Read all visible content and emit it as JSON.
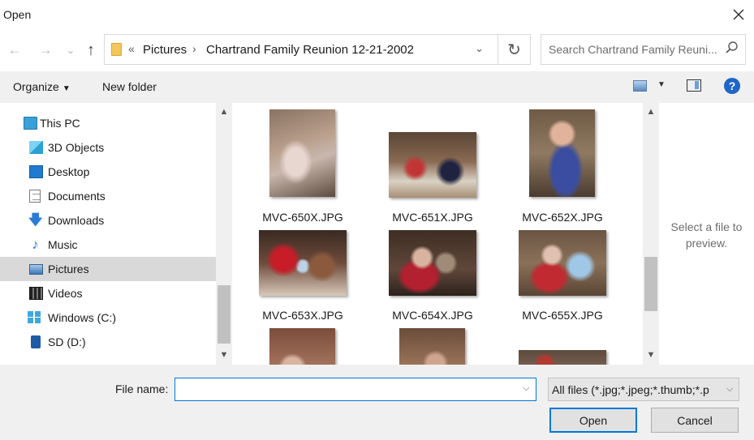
{
  "window": {
    "title": "Open"
  },
  "nav": {
    "back": "←",
    "forward": "→",
    "recent": "⌄",
    "up": "↑"
  },
  "address": {
    "overflow": "«",
    "crumbs": [
      "Pictures",
      "Chartrand Family Reunion 12-21-2002"
    ],
    "separator": "›",
    "dropdown": "⌄",
    "refresh": "↻"
  },
  "search": {
    "placeholder": "Search Chartrand Family Reuni..."
  },
  "toolbar": {
    "organize_label": "Organize",
    "new_folder_label": "New folder",
    "help": "?"
  },
  "sidebar": {
    "items": [
      {
        "label": "This PC",
        "icon": "pc-icon"
      },
      {
        "label": "3D Objects",
        "icon": "cube-icon"
      },
      {
        "label": "Desktop",
        "icon": "desktop-icon"
      },
      {
        "label": "Documents",
        "icon": "document-icon"
      },
      {
        "label": "Downloads",
        "icon": "download-arrow-icon"
      },
      {
        "label": "Music",
        "icon": "music-note-icon"
      },
      {
        "label": "Pictures",
        "icon": "pictures-icon",
        "selected": true
      },
      {
        "label": "Videos",
        "icon": "film-icon"
      },
      {
        "label": "Windows (C:)",
        "icon": "windows-drive-icon"
      },
      {
        "label": "SD (D:)",
        "icon": "sd-card-icon"
      }
    ]
  },
  "files": [
    {
      "name": "MVC-650X.JPG"
    },
    {
      "name": "MVC-651X.JPG"
    },
    {
      "name": "MVC-652X.JPG"
    },
    {
      "name": "MVC-653X.JPG"
    },
    {
      "name": "MVC-654X.JPG"
    },
    {
      "name": "MVC-655X.JPG"
    },
    {
      "name": ""
    },
    {
      "name": ""
    },
    {
      "name": ""
    }
  ],
  "preview": {
    "message": "Select a file to preview."
  },
  "footer": {
    "file_name_label": "File name:",
    "file_name_value": "",
    "filter_value": "All files (*.jpg;*.jpeg;*.thumb;*.p",
    "open_label": "Open",
    "cancel_label": "Cancel"
  },
  "colors": {
    "accent": "#0078d7",
    "selected_bg": "#d9d9d9",
    "chrome_bg": "#f0f0f0"
  }
}
